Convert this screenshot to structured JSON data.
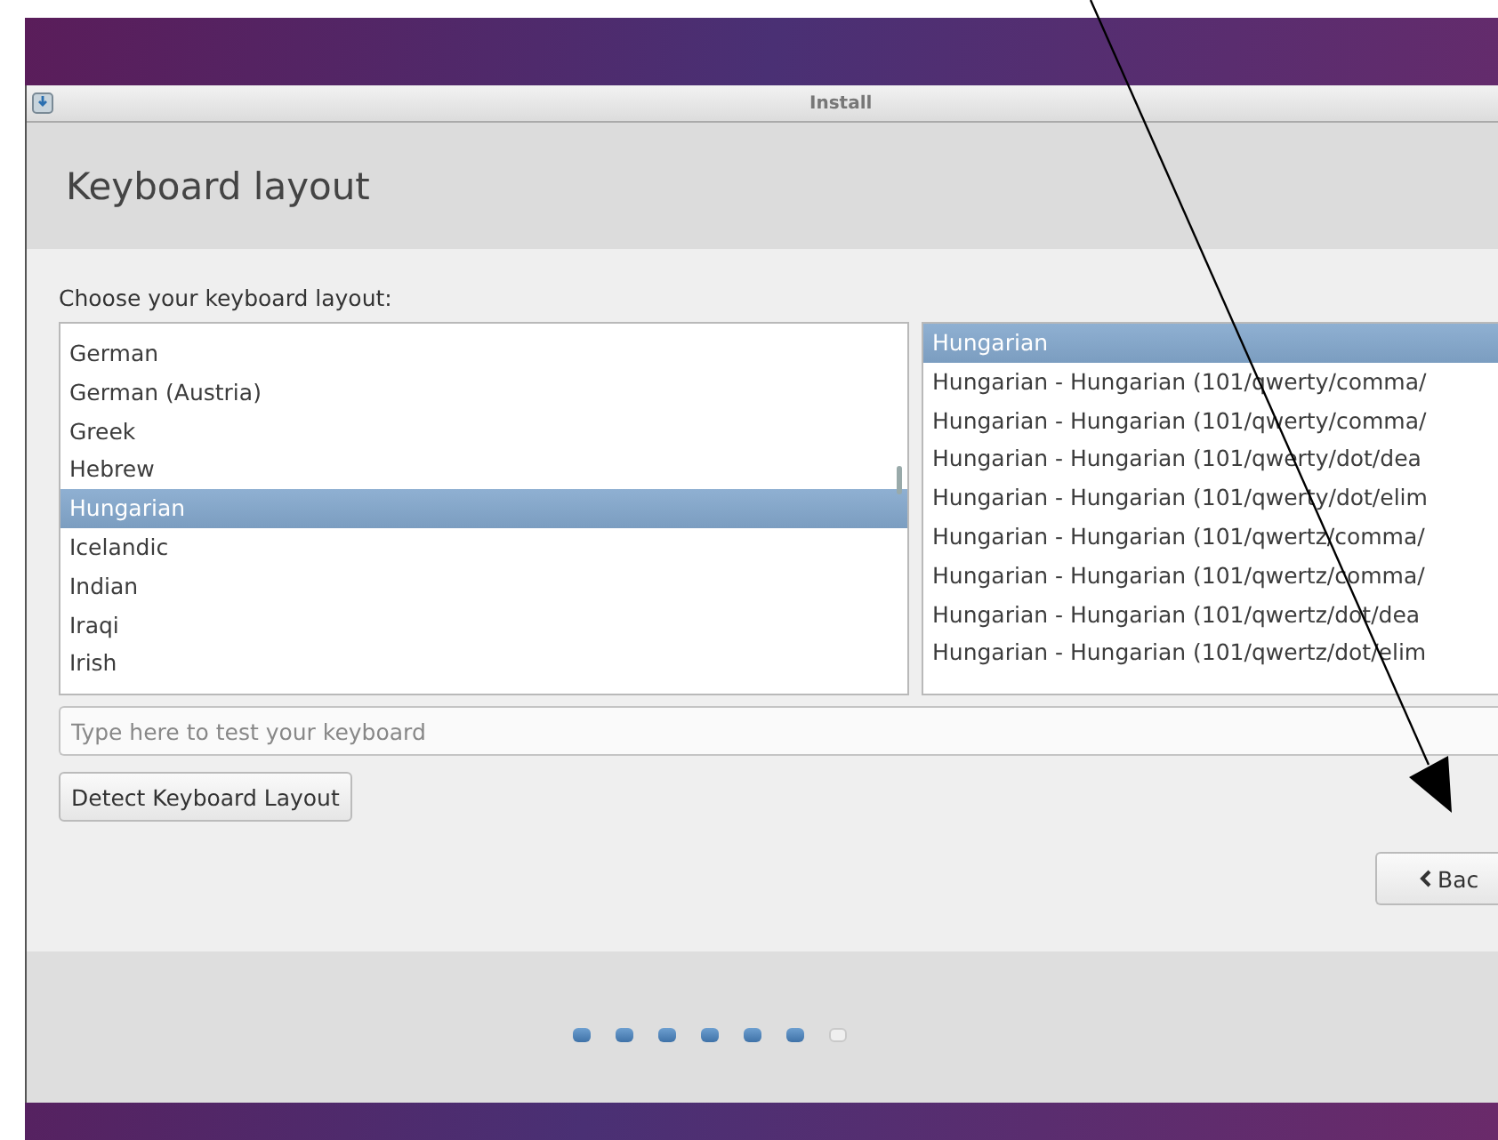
{
  "window": {
    "title": "Install"
  },
  "header": {
    "title": "Keyboard layout"
  },
  "prompt": "Choose your keyboard layout:",
  "layouts": [
    {
      "label": "German",
      "selected": false
    },
    {
      "label": "German (Austria)",
      "selected": false
    },
    {
      "label": "Greek",
      "selected": false
    },
    {
      "label": "Hebrew",
      "selected": false
    },
    {
      "label": "Hungarian",
      "selected": true
    },
    {
      "label": "Icelandic",
      "selected": false
    },
    {
      "label": "Indian",
      "selected": false
    },
    {
      "label": "Iraqi",
      "selected": false
    },
    {
      "label": "Irish",
      "selected": false
    }
  ],
  "variants": [
    {
      "label": "Hungarian",
      "selected": true
    },
    {
      "label": "Hungarian - Hungarian (101/qwerty/comma/",
      "selected": false
    },
    {
      "label": "Hungarian - Hungarian (101/qwerty/comma/",
      "selected": false
    },
    {
      "label": "Hungarian - Hungarian (101/qwerty/dot/dea",
      "selected": false
    },
    {
      "label": "Hungarian - Hungarian (101/qwerty/dot/elim",
      "selected": false
    },
    {
      "label": "Hungarian - Hungarian (101/qwertz/comma/",
      "selected": false
    },
    {
      "label": "Hungarian - Hungarian (101/qwertz/comma/",
      "selected": false
    },
    {
      "label": "Hungarian - Hungarian (101/qwertz/dot/dea",
      "selected": false
    },
    {
      "label": "Hungarian - Hungarian (101/qwertz/dot/elim",
      "selected": false
    }
  ],
  "test_field": {
    "placeholder": "Type here to test your keyboard"
  },
  "detect_button": "Detect Keyboard Layout",
  "back_button": "Bac",
  "steps": [
    {
      "done": true
    },
    {
      "done": true
    },
    {
      "done": true
    },
    {
      "done": true
    },
    {
      "done": true
    },
    {
      "done": true
    },
    {
      "done": false
    }
  ]
}
